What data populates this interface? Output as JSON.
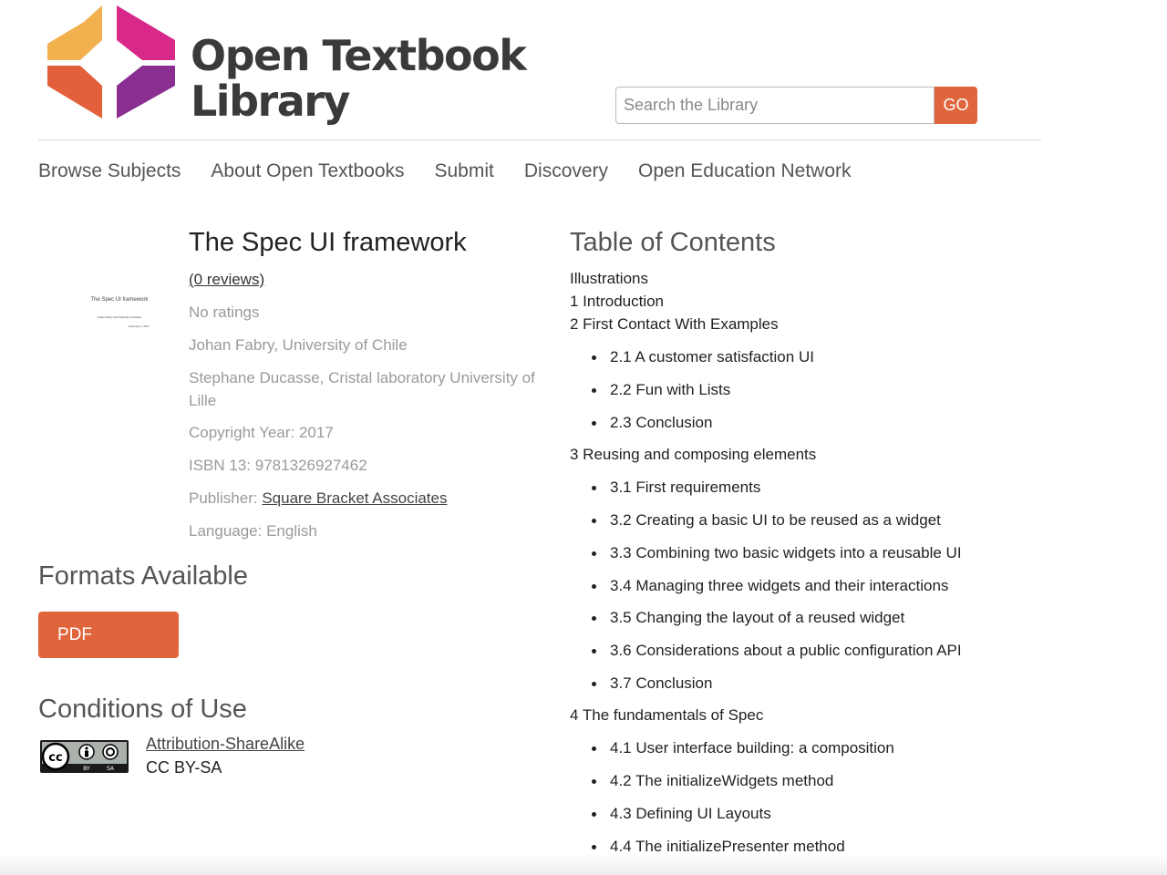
{
  "header": {
    "logo_line1": "Open Textbook",
    "logo_line2": "Library",
    "search_placeholder": "Search the Library",
    "search_button": "GO"
  },
  "nav": [
    "Browse Subjects",
    "About Open Textbooks",
    "Submit",
    "Discovery",
    "Open Education Network"
  ],
  "book": {
    "cover_title": "The Spec UI framework",
    "cover_authors": "Johan Fabry and Stephane Ducasse",
    "cover_date": "February 3, 2017",
    "title": "The Spec UI framework",
    "reviews": "(0 reviews)",
    "ratings": "No ratings",
    "author1": "Johan Fabry, University of Chile",
    "author2": "Stephane Ducasse, Cristal laboratory University of Lille",
    "copyright": "Copyright Year: 2017",
    "isbn": "ISBN 13: 9781326927462",
    "publisher_label": "Publisher: ",
    "publisher": "Square Bracket Associates",
    "language": "Language: English"
  },
  "formats": {
    "heading": "Formats Available",
    "pdf": "PDF"
  },
  "conditions": {
    "heading": "Conditions of Use",
    "license_name": "Attribution-ShareAlike",
    "license_code": "CC BY-SA",
    "badge_by": "BY",
    "badge_sa": "SA"
  },
  "toc": {
    "heading": "Table of Contents",
    "items": [
      "Illustrations",
      "1 Introduction",
      "2 First Contact With Examples",
      "2.1 A customer satisfaction UI",
      "2.2 Fun with Lists",
      "2.3 Conclusion",
      "3 Reusing and composing elements",
      "3.1 First requirements",
      "3.2 Creating a basic UI to be reused as a widget",
      "3.3 Combining two basic widgets into a reusable UI",
      "3.4 Managing three widgets and their interactions",
      "3.5 Changing the layout of a reused widget",
      "3.6 Considerations about a public configuration API",
      "3.7 Conclusion",
      "4 The fundamentals of Spec",
      "4.1 User interface building: a composition",
      "4.2 The initializeWidgets method",
      "4.3 Defining UI Layouts",
      "4.4 The initializePresenter method"
    ]
  },
  "colors": {
    "accent": "#e0653c",
    "logo_yellow": "#f2b04f",
    "logo_orange": "#e2603a",
    "logo_magenta": "#d8298b",
    "logo_purple": "#8a2f91"
  }
}
